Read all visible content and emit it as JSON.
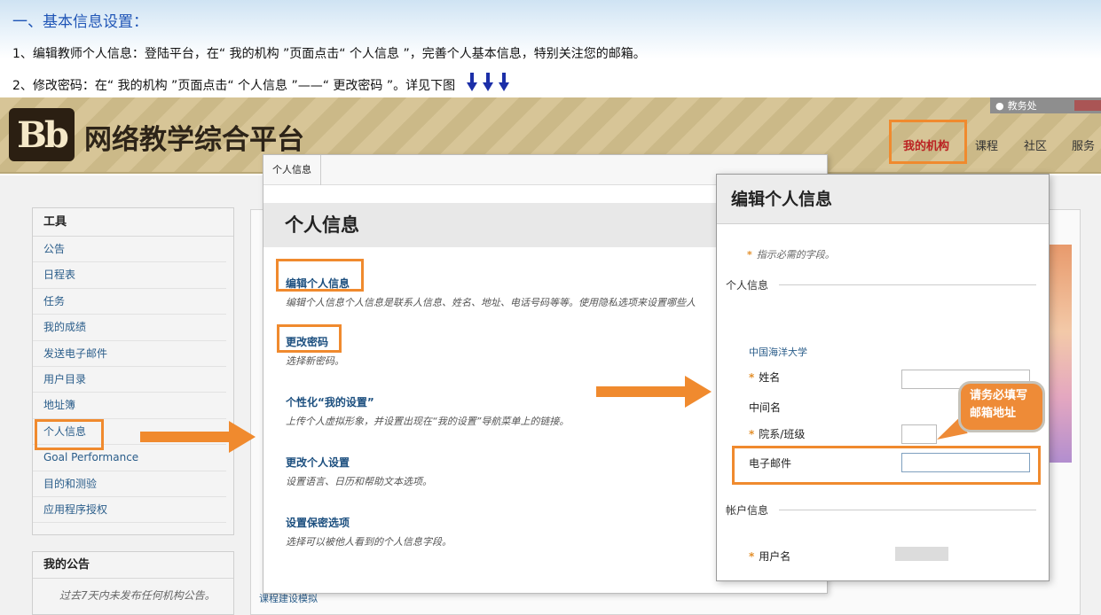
{
  "instructions": {
    "title": "一、基本信息设置：",
    "line1": "1、编辑教师个人信息：登陆平台，在“ 我的机构 ”页面点击“ 个人信息 ”，完善个人基本信息，特别关注您的邮箱。",
    "line2": "2、修改密码：在“ 我的机构 ”页面点击“ 个人信息 ”——“ 更改密码 ”。详见下图",
    "arrow_color": "#1c2fa8"
  },
  "header": {
    "logo": "Bb",
    "platform_title": "网络教学综合平台",
    "user_label": "教务处",
    "tabs": [
      "我的机构",
      "课程",
      "社区",
      "服务"
    ]
  },
  "sidebar": {
    "tools_heading": "工具",
    "tools": [
      "公告",
      "日程表",
      "任务",
      "我的成绩",
      "发送电子邮件",
      "用户目录",
      "地址簿",
      "个人信息",
      "Goal Performance",
      "目的和测验",
      "应用程序授权"
    ],
    "announce_heading": "我的公告",
    "announce_text": "过去7天内未发布任何机构公告。"
  },
  "content": {
    "bottom_link": "课程建设模拟"
  },
  "personal_info": {
    "breadcrumb": "个人信息",
    "title": "个人信息",
    "items": [
      {
        "label": "编辑个人信息",
        "desc": "编辑个人信息个人信息是联系人信息、姓名、地址、电话号码等等。使用隐私选项来设置哪些人"
      },
      {
        "label": "更改密码",
        "desc": "选择新密码。"
      },
      {
        "label": "个性化“我的设置”",
        "desc": "上传个人虚拟形象，并设置出现在“我的设置”导航菜单上的链接。"
      },
      {
        "label": "更改个人设置",
        "desc": "设置语言、日历和帮助文本选项。"
      },
      {
        "label": "设置保密选项",
        "desc": "选择可以被他人看到的个人信息字段。"
      }
    ]
  },
  "edit_info": {
    "title": "编辑个人信息",
    "required_note": "指示必需的字段。",
    "section_personal": "个人信息",
    "institution": "中国海洋大学",
    "name_label": "姓名",
    "middle_label": "中间名",
    "dept_label": "院系/班级",
    "email_label": "电子邮件",
    "section_account": "帐户信息",
    "username_label": "用户名"
  },
  "callout": {
    "line1": "请务必填写",
    "line2": "邮箱地址"
  },
  "colors": {
    "highlight": "#f08a2e",
    "instruction_title": "#1f55b6",
    "link": "#1c4f7f"
  }
}
